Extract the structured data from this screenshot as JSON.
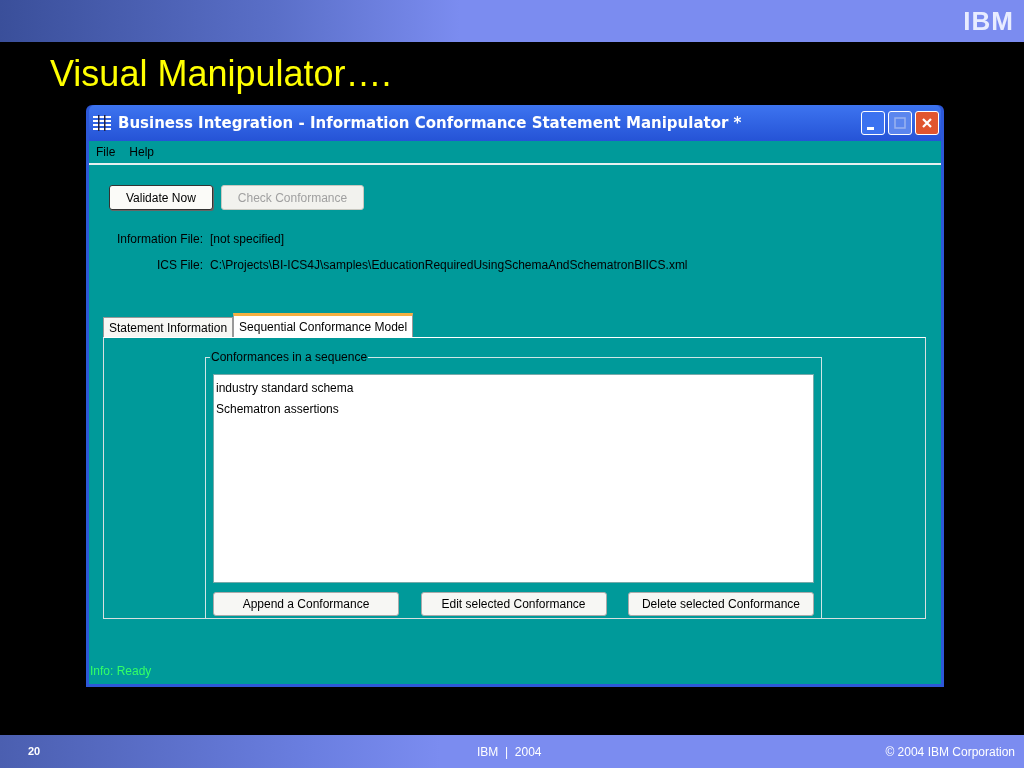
{
  "slide": {
    "title": "Visual Manipulator….",
    "logo": "IBM",
    "page_number": "20",
    "footer_center": "IBM  |  2004",
    "copyright": "© 2004 IBM Corporation"
  },
  "window": {
    "title": "Business Integration - Information Conformance Statement Manipulator *"
  },
  "menu": [
    "File",
    "Help"
  ],
  "toolbar": [
    {
      "label": "Validate Now",
      "disabled": false
    },
    {
      "label": "Check Conformance",
      "disabled": true
    }
  ],
  "fields": [
    {
      "label": "Information File:",
      "value": "[not specified]"
    },
    {
      "label": "ICS File:",
      "value": "C:\\Projects\\BI-ICS4J\\samples\\EducationRequiredUsingSchemaAndSchematronBIICS.xml"
    }
  ],
  "tabs": [
    {
      "label": "Statement Information",
      "selected": false
    },
    {
      "label": "Sequential Conformance Model",
      "selected": true
    }
  ],
  "group": {
    "title": "Conformances in a sequence",
    "items": [
      "industry standard schema",
      "Schematron assertions"
    ],
    "buttons": [
      "Append a Conformance",
      "Edit selected Conformance",
      "Delete selected Conformance"
    ]
  },
  "status": "Info: Ready"
}
